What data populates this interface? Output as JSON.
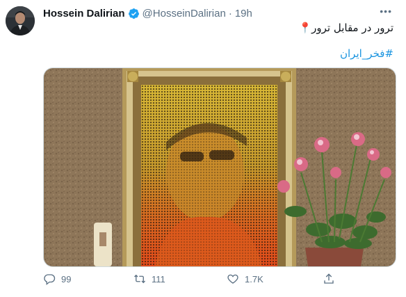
{
  "tweet": {
    "author_name": "Hossein Dalirian",
    "handle": "@HosseinDalirian",
    "separator": "·",
    "time": "19h",
    "more": "•••",
    "text": "ترور در مقابل ترور📍",
    "hashtag": "#فخر_ایران"
  },
  "actions": {
    "replies": "99",
    "retweets": "111",
    "likes": "1.7K"
  },
  "colors": {
    "link": "#1b95e0",
    "verified": "#1da1f2",
    "muted": "#5b7083"
  },
  "icons": [
    "verified-badge-icon",
    "more-icon",
    "reply-icon",
    "retweet-icon",
    "like-icon",
    "share-icon"
  ]
}
